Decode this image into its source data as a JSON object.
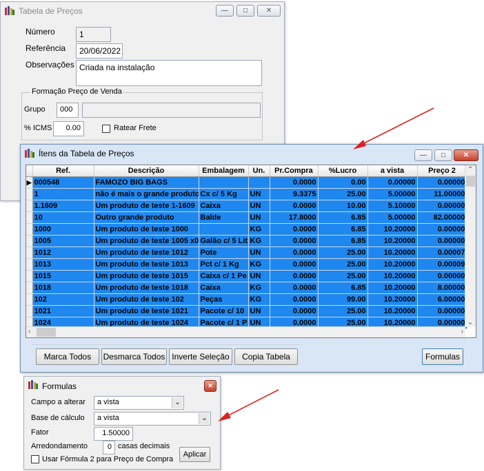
{
  "tabela": {
    "title": "Tabela de Preços",
    "numero_label": "Número",
    "numero_value": "1",
    "referencia_label": "Referência",
    "referencia_value": "20/06/2022",
    "observacoes_label": "Observações",
    "observacoes_value": "Criada na instalação",
    "formacao_label": "Formação Preço de Venda",
    "grupo_label": "Grupo",
    "grupo_value": "000",
    "icms_label": "% ICMS",
    "icms_value": "0.00",
    "ratear_label": "Ratear Frete"
  },
  "itens": {
    "title": "Ítens da Tabela de Preços",
    "columns": [
      "Ref.",
      "Descrição",
      "Embalagem",
      "Un.",
      "Pr.Compra",
      "%Lucro",
      "a vista",
      "Preço 2"
    ],
    "rows": [
      {
        "ref": "000548",
        "desc": "FAMOZO BIG BAGS",
        "emb": "",
        "un": "",
        "compra": "0.0000",
        "lucro": "0.00",
        "vista": "0.00000",
        "preco2": "0.00000"
      },
      {
        "ref": "1",
        "desc": "não é mais o grande produto",
        "emb": "Cx c/ 5 Kg",
        "un": "UN",
        "compra": "9.3375",
        "lucro": "25.00",
        "vista": "5.00000",
        "preco2": "11.00000"
      },
      {
        "ref": "1.1609",
        "desc": "Um produto de teste 1-1609",
        "emb": "Caixa",
        "un": "UN",
        "compra": "0.0000",
        "lucro": "10.00",
        "vista": "5.10000",
        "preco2": "0.00000"
      },
      {
        "ref": "10",
        "desc": "Outro grande produto",
        "emb": "Balde",
        "un": "UN",
        "compra": "17.8000",
        "lucro": "6.85",
        "vista": "5.00000",
        "preco2": "82.00000"
      },
      {
        "ref": "1000",
        "desc": "Um produto de teste 1000",
        "emb": "",
        "un": "KG",
        "compra": "0.0000",
        "lucro": "6.85",
        "vista": "10.20000",
        "preco2": "0.00000"
      },
      {
        "ref": "1005",
        "desc": "Um produto de teste 1005 x0",
        "emb": "Galão c/ 5 Lit",
        "un": "KG",
        "compra": "0.0000",
        "lucro": "6.85",
        "vista": "10.20000",
        "preco2": "0.00000"
      },
      {
        "ref": "1012",
        "desc": "Um produto de teste 1012",
        "emb": "Pote",
        "un": "UN",
        "compra": "0.0000",
        "lucro": "25.00",
        "vista": "10.20000",
        "preco2": "0.00007"
      },
      {
        "ref": "1013",
        "desc": "Um produto de teste 1013",
        "emb": "Pct c/ 1 Kg",
        "un": "KG",
        "compra": "0.0000",
        "lucro": "25.00",
        "vista": "10.20000",
        "preco2": "0.00009"
      },
      {
        "ref": "1015",
        "desc": "Um produto de teste 1015",
        "emb": "Caixa c/ 1 Pe",
        "un": "UN",
        "compra": "0.0000",
        "lucro": "25.00",
        "vista": "10.20000",
        "preco2": "0.00000"
      },
      {
        "ref": "1018",
        "desc": "Um produto de teste 1018",
        "emb": "Caixa",
        "un": "KG",
        "compra": "0.0000",
        "lucro": "6.85",
        "vista": "10.20000",
        "preco2": "8.00000"
      },
      {
        "ref": "102",
        "desc": "Um produto de teste 102",
        "emb": "Peças",
        "un": "KG",
        "compra": "0.0000",
        "lucro": "99.00",
        "vista": "10.20000",
        "preco2": "6.00000"
      },
      {
        "ref": "1021",
        "desc": "Um produto de teste 1021",
        "emb": "Pacote c/ 10",
        "un": "UN",
        "compra": "0.0000",
        "lucro": "25.00",
        "vista": "10.20000",
        "preco2": "0.00000"
      },
      {
        "ref": "1024",
        "desc": "Um produto de teste 1024",
        "emb": "Pacote c/ 1 P",
        "un": "UN",
        "compra": "0.0000",
        "lucro": "25.00",
        "vista": "10.20000",
        "preco2": "0.00000"
      }
    ],
    "btn_marca": "Marca Todos",
    "btn_desmarca": "Desmarca Todos",
    "btn_inverte": "Inverte Seleção",
    "btn_copia": "Copia Tabela",
    "btn_formulas": "Formulas"
  },
  "formulas": {
    "title": "Formulas",
    "campo_label": "Campo a alterar",
    "campo_value": "a vista",
    "base_label": "Base de cálculo",
    "base_value": "a vista",
    "fator_label": "Fator",
    "fator_value": "1.50000",
    "arred_label": "Arredondamento",
    "arred_value": "0",
    "casas_label": "casas decimais",
    "usar_label": "Usar Fórmula 2 para Preço de Compra",
    "aplicar_label": "Aplicar"
  },
  "colors": {
    "selection": "#1e88f0",
    "arrow": "#e02020"
  }
}
